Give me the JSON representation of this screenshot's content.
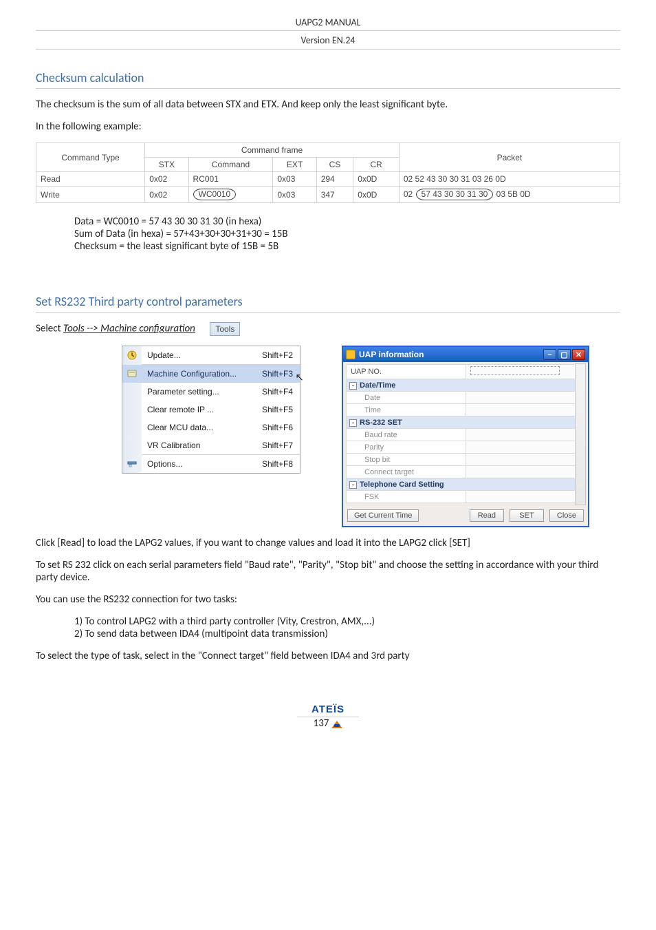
{
  "header": {
    "title": "UAPG2  MANUAL",
    "version": "Version EN.24"
  },
  "sections": {
    "checksum": {
      "heading": "Checksum calculation",
      "p1": "The checksum is the sum of all data between STX and ETX. And keep only the least significant byte.",
      "p2": "In the following example:"
    },
    "rs232": {
      "heading": "Set RS232 Third party control parameters",
      "select_label": "Select ",
      "select_path": "Tools --> Machine configuration",
      "p_click": "Click [Read] to load the LAPG2 values, if you want to change values and load it into the LAPG2 click [SET]",
      "p_set": "To set RS 232 click on each serial parameters field \"Baud rate\", \"Parity\", \"Stop bit\"  and choose the setting in accordance with your third party device.",
      "p_use": "You can use the RS232 connection for two tasks:",
      "task1": "1) To control LAPG2 with a third party controller (Vity, Crestron, AMX,...)",
      "task2": "2) To send data between IDA4 (multipoint data transmission)",
      "p_select_type": "To select the type of task, select in the \"Connect target\" field between IDA4 and 3rd party"
    }
  },
  "table": {
    "headers": {
      "cmdtype": "Command Type",
      "frame": "Command frame",
      "packet": "Packet",
      "stx": "STX",
      "command": "Command",
      "ext": "EXT",
      "cs": "CS",
      "cr": "CR"
    },
    "rows": [
      {
        "type": "Read",
        "stx": "0x02",
        "cmd": "RC001",
        "ext": "0x03",
        "cs": "294",
        "cr": "0x0D",
        "packet_pre": "02 52 43 30 30 31 03 26 0D"
      },
      {
        "type": "Write",
        "stx": "0x02",
        "cmd": "WC0010",
        "ext": "0x03",
        "cs": "347",
        "cr": "0x0D",
        "packet_pre": "02",
        "packet_mid": "57 43 30 30 31 30",
        "packet_post": "03 5B 0D"
      }
    ]
  },
  "calc": {
    "l1": "Data = WC0010  = 57 43 30 30 31 30  (in hexa)",
    "l2": "Sum of Data (in hexa) = 57+43+30+30+31+30 = 15B",
    "l3": "Checksum =  the least significant byte of 15B =   5B"
  },
  "tools_button": {
    "label": "Tools"
  },
  "menu": {
    "items": [
      {
        "label": "Update...",
        "shortcut": "Shift+F2",
        "icon": "update"
      },
      {
        "label": "Machine Configuration...",
        "shortcut": "Shift+F3",
        "icon": "machine",
        "selected": true
      },
      {
        "label": "Parameter setting...",
        "shortcut": "Shift+F4"
      },
      {
        "label": "Clear remote IP ...",
        "shortcut": "Shift+F5"
      },
      {
        "label": "Clear MCU data...",
        "shortcut": "Shift+F6"
      },
      {
        "label": "VR Calibration",
        "shortcut": "Shift+F7"
      },
      {
        "label": "Options...",
        "shortcut": "Shift+F8",
        "icon": "options"
      }
    ]
  },
  "uap": {
    "title": "UAP information",
    "rows": [
      {
        "k": "UAP NO.",
        "v_dash": true
      },
      {
        "grp": true,
        "toggle": "-",
        "k": "Date/Time"
      },
      {
        "indent": true,
        "k": "Date"
      },
      {
        "indent": true,
        "k": "Time"
      },
      {
        "grp": true,
        "toggle": "-",
        "k": "RS-232 SET"
      },
      {
        "indent": true,
        "k": "Baud rate"
      },
      {
        "indent": true,
        "k": "Parity"
      },
      {
        "indent": true,
        "k": "Stop bit"
      },
      {
        "indent": true,
        "k": "Connect target"
      },
      {
        "grp": true,
        "toggle": "-",
        "k": "Telephone Card Setting"
      },
      {
        "indent": true,
        "k": "FSK"
      }
    ],
    "buttons": {
      "gct": "Get Current Time",
      "read": "Read",
      "set": "SET",
      "close": "Close"
    }
  },
  "footer": {
    "brand_letters": "ATEÏS",
    "page": "137"
  }
}
